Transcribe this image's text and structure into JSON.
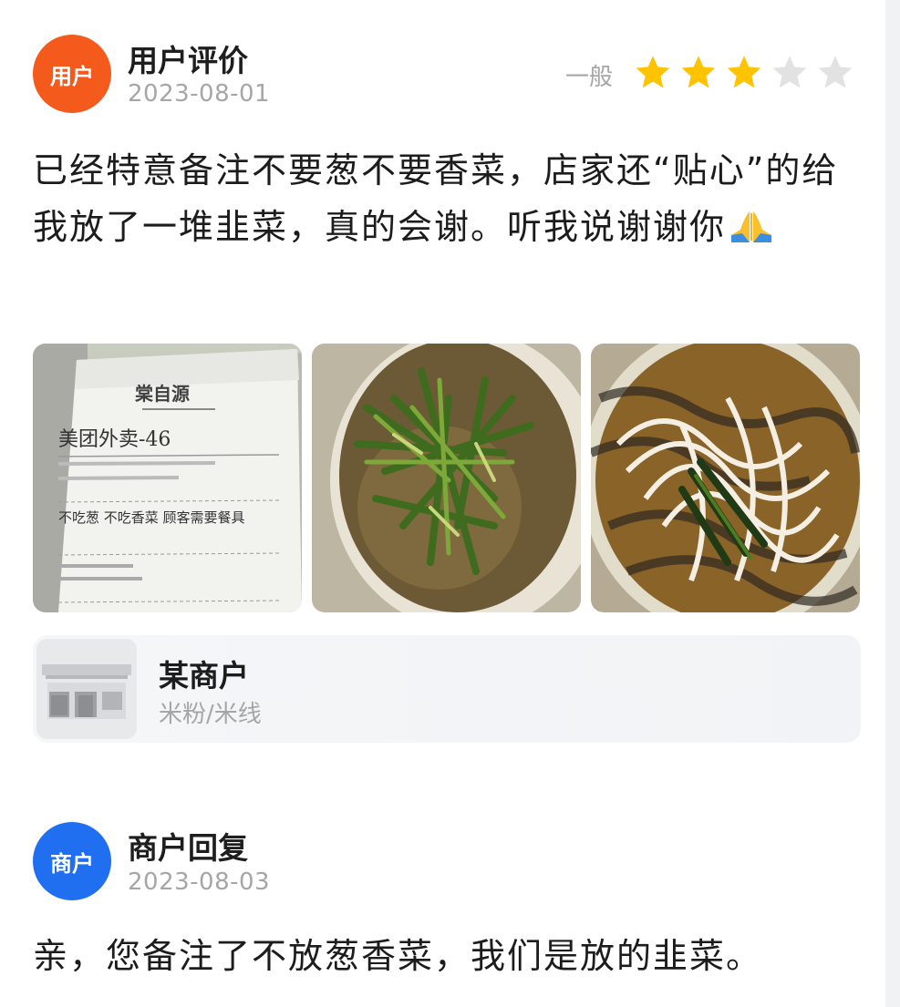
{
  "review": {
    "avatar_label": "用户",
    "avatar_color": "#f45a1c",
    "user_name": "用户评价",
    "date": "2023-08-01",
    "rating_label": "一般",
    "rating": 3,
    "rating_max": 5,
    "star_on_color": "#ffc300",
    "star_off_color": "#e2e2e2",
    "text": "已经特意备注不要葱不要香菜，店家还“贴心”的给我放了一堆韭菜，真的会谢。听我说谢谢你",
    "emoji": "pray-emoji",
    "photos": [
      {
        "name": "receipt-photo",
        "header": "棠自源",
        "order": "美团外卖-46",
        "notes": "不吃葱 不吃香菜 顾客需要餐具"
      },
      {
        "name": "soup-photo"
      },
      {
        "name": "noodle-photo"
      }
    ]
  },
  "merchant": {
    "name": "某商户",
    "category": "米粉/米线",
    "icon": "shop-icon"
  },
  "reply": {
    "avatar_label": "商户",
    "avatar_color": "#1f6ff0",
    "user_name": "商户回复",
    "date": "2023-08-03",
    "text": "亲，您备注了不放葱香菜，我们是放的韭菜。"
  }
}
